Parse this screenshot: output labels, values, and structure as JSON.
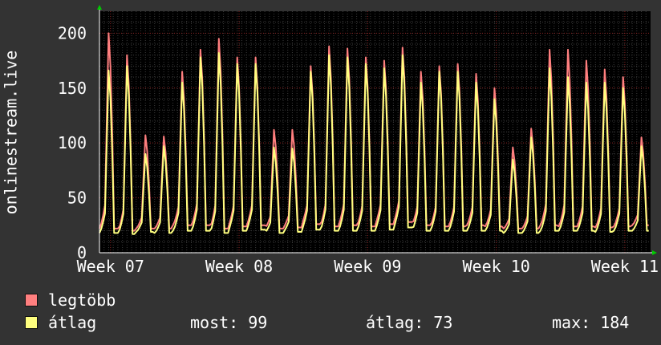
{
  "chart_data": {
    "type": "line",
    "ylabel": "onlinestream.live",
    "x_ticks": [
      "Week 07",
      "Week 08",
      "Week 09",
      "Week 10",
      "Week 11"
    ],
    "yticks": [
      0,
      50,
      100,
      150,
      200
    ],
    "ylim": [
      0,
      220
    ],
    "grid": true,
    "series": [
      {
        "name": "legtöbb",
        "color": "#ff7f7f",
        "daily_peaks": [
          200,
          180,
          107,
          106,
          165,
          185,
          195,
          178,
          178,
          112,
          112,
          170,
          188,
          186,
          178,
          175,
          187,
          165,
          170,
          172,
          163,
          150,
          96,
          113,
          185,
          185,
          175,
          167,
          160,
          105
        ],
        "daily_lows": [
          22,
          20,
          22,
          22,
          25,
          25,
          22,
          24,
          25,
          22,
          23,
          26,
          24,
          25,
          24,
          26,
          28,
          25,
          24,
          24,
          25,
          24,
          22,
          22,
          25,
          24,
          24,
          23,
          24,
          25
        ]
      },
      {
        "name": "átlag",
        "color": "#ffff7f",
        "daily_peaks": [
          166,
          170,
          90,
          97,
          155,
          178,
          182,
          172,
          172,
          96,
          95,
          165,
          180,
          178,
          172,
          168,
          180,
          155,
          165,
          165,
          155,
          140,
          85,
          105,
          168,
          160,
          155,
          155,
          150,
          97
        ],
        "daily_lows": [
          18,
          17,
          19,
          18,
          20,
          20,
          18,
          20,
          21,
          18,
          19,
          21,
          20,
          20,
          20,
          21,
          23,
          20,
          20,
          20,
          20,
          20,
          18,
          18,
          20,
          20,
          20,
          19,
          20,
          20
        ]
      }
    ],
    "legend": [
      {
        "label": "legtöbb",
        "color": "#ff7f7f"
      },
      {
        "label": "átlag",
        "color": "#ffff7f"
      }
    ],
    "stats": {
      "now": "most: 99",
      "avg": "átlag: 73",
      "max": "max: 184"
    }
  }
}
